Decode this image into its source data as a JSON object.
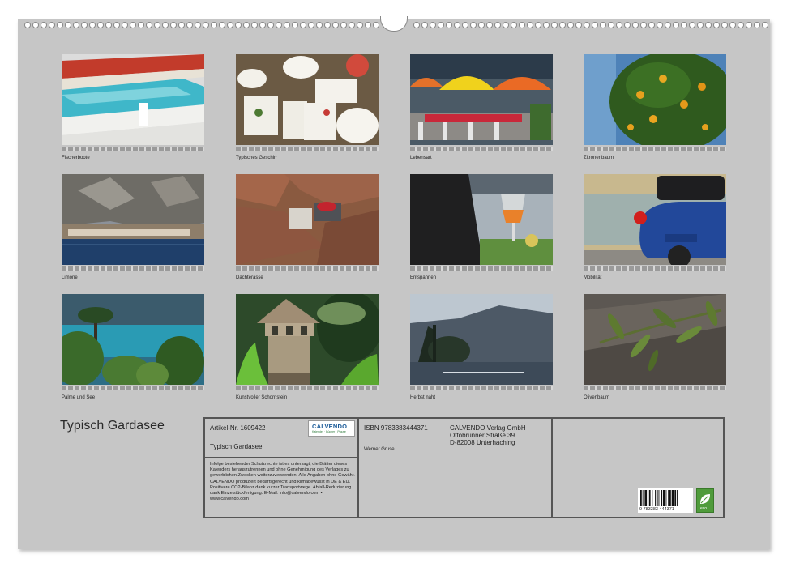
{
  "title": "Typisch Gardasee",
  "captions": {
    "c1": "Fischerboote",
    "c2": "Typisches Geschirr",
    "c3": "Lebensart",
    "c4": "Zitronenbaum",
    "c5": "Limone",
    "c6": "Dachterasse",
    "c7": "Entspannen",
    "c8": "Mobilität",
    "c9": "Palme und See",
    "c10": "Kunstvoller Schornstein",
    "c11": "Herbst naht",
    "c12": "Olivenbaum"
  },
  "info": {
    "article": "Artikel-Nr. 1609422",
    "logo": "CALVENDO",
    "logo_sub": "Kalender · Bücher · Puzzle",
    "calendar_title": "Typisch Gardasee",
    "isbn": "ISBN 9783383444371",
    "author": "Werner Gruse",
    "publisher_name": "CALVENDO Verlag GmbH",
    "publisher_street": "Ottobrunner Straße 39",
    "publisher_city": "D-82008 Unterhaching",
    "legal": "Infolge bestehender Schutzrechte ist es untersagt, die Blätter dieses Kalenders herauszutrennen und ohne Genehmigung des Verlages zu gewerblichen Zwecken weiterzuverwenden. Alle Angaben ohne Gewähr. CALVENDO produziert bedarfsgerecht und klimabewusst in DE & EU. Positivere CO2-Bilanz dank kurzer Transportwege. Abfall-Reduzierung dank Einzelstückfertigung. E-Mail: info@calvendo.com • www.calvendo.com",
    "barcode_number": "9 783383 444371",
    "eco_label": "eco"
  },
  "colors": {
    "page_background": "#c6c6c6",
    "frame": "#555555"
  }
}
